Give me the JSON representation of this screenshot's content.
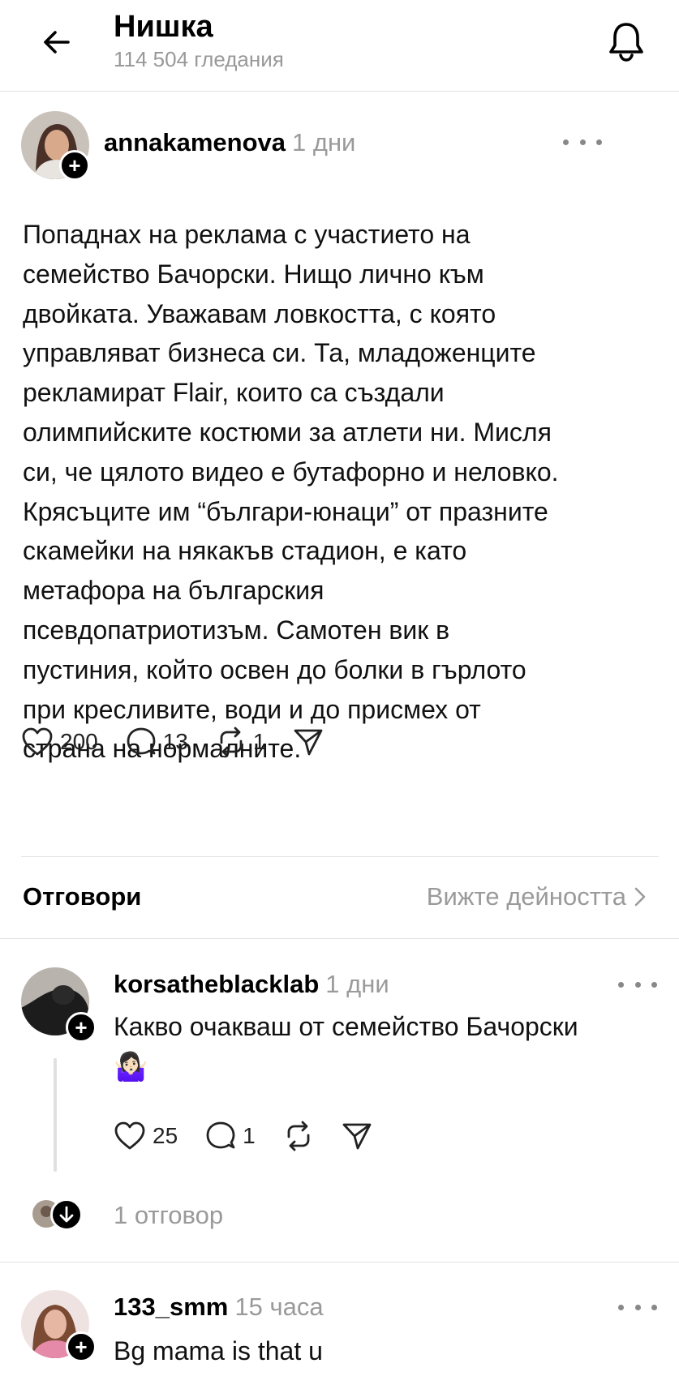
{
  "header": {
    "title": "Нишка",
    "views": "114 504 гледания",
    "back_icon": "arrow-left-icon",
    "bell_icon": "bell-icon"
  },
  "post": {
    "username": "annakamenova",
    "time": "1 дни",
    "text": "Попаднах на реклама с участието на\nсемейство Бачорски. Нищо лично към\nдвойката. Уважавам ловкостта, с която\nуправляват бизнеса си. Та, младоженците\nрекламират Flair, които са създали\nолимпийските костюми за атлети ни. Мисля\nси, че цялото видео е бутафорно и неловко.\nКрясъците им “българи-юнаци” от празните\nскамейки на някакъв стадион, е като\nметафора на българския\nпсевдопатриотизъм. Самотен вик в\nпустиния, който освен до болки в гърлото\nпри кресливите, води и до присмех от\nстрана на нормалните.",
    "likes": "200",
    "comments": "13",
    "reposts": "1"
  },
  "replies_section": {
    "title": "Отговори",
    "view_activity": "Вижте дейността"
  },
  "replies": [
    {
      "username": "korsatheblacklab",
      "time": "1 дни",
      "text": "Какво очакваш от семейство Бачорски",
      "emoji": "🤷🏻‍♀️",
      "likes": "25",
      "comments": "1",
      "reply_count": "1 отговор"
    },
    {
      "username": "133_smm",
      "time": "15 часа",
      "text": "Bg mama is that u"
    }
  ],
  "colors": {
    "text": "#111111",
    "muted": "#9a9a9a",
    "divider": "#e2e2e2",
    "badge": "#000000"
  }
}
